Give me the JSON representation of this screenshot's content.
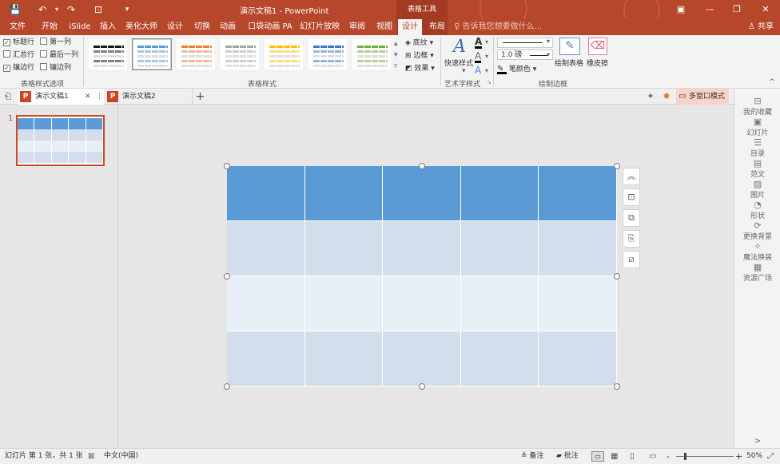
{
  "window": {
    "title": "演示文稿1 - PowerPoint",
    "context_tools": "表格工具",
    "qat": {
      "save_icon": "💾",
      "undo_icon": "↶",
      "redo_icon": "↷",
      "present_icon": "⊡",
      "customize_icon": "▾"
    },
    "controls": {
      "restore_icon": "▣",
      "minimize_icon": "—",
      "maximize_icon": "❐",
      "close_icon": "✕"
    }
  },
  "menu": {
    "tabs": [
      "文件",
      "开始",
      "iSlide",
      "插入",
      "美化大师",
      "设计",
      "切换",
      "动画",
      "口袋动画 PA",
      "幻灯片放映",
      "审阅",
      "视图",
      "设计",
      "布局"
    ],
    "active_tab_index": 12,
    "tell_me": "告诉我您想要做什么...",
    "share": "共享"
  },
  "ribbon": {
    "table_style_options": {
      "header_row": "标题行",
      "first_column": "第一列",
      "total_row": "汇总行",
      "last_column": "最后一列",
      "banded_rows": "镶边行",
      "banded_columns": "镶边列",
      "checked": {
        "header_row": true,
        "total_row": false,
        "banded_rows": true,
        "first_column": false,
        "last_column": false,
        "banded_columns": false
      },
      "group_label": "表格样式选项"
    },
    "table_styles": {
      "group_label": "表格样式",
      "swatches": [
        "#1a1a1a",
        "#5b9bd5",
        "#ed7d31",
        "#a5a5a5",
        "#ffc000",
        "#4472c4",
        "#70ad47"
      ],
      "selected_index": 1,
      "shading": "底纹",
      "borders": "边框",
      "effects": "效果"
    },
    "wordart": {
      "quick_styles": "快速样式",
      "group_label": "艺术字样式",
      "text_fill_letter": "A",
      "text_outline_letter": "A",
      "text_effects_letter": "A"
    },
    "draw_borders": {
      "pen_weight": "1.0 磅",
      "pen_color": "笔颜色",
      "draw_table": "绘制表格",
      "eraser": "橡皮擦",
      "group_label": "绘制边框"
    }
  },
  "doc_tabs": {
    "tabs": [
      "演示文稿1",
      "演示文稿2"
    ],
    "active_index": 0,
    "new_tab": "+",
    "multi_window": "多窗口模式"
  },
  "slides_pane": {
    "slide_number": "1"
  },
  "table": {
    "rows": 4,
    "cols": 5,
    "header_color": "#5b9bd5",
    "band_color_1": "#d2deeb",
    "band_color_2": "#e9eff7"
  },
  "side_pane": {
    "items": [
      {
        "label": "我的收藏",
        "icon": "⊟"
      },
      {
        "label": "幻灯片",
        "icon": "▣"
      },
      {
        "label": "目录",
        "icon": "☰"
      },
      {
        "label": "范文",
        "icon": "▤"
      },
      {
        "label": "图片",
        "icon": "▨"
      },
      {
        "label": "形状",
        "icon": "◔"
      },
      {
        "label": "更换背景",
        "icon": "⟳"
      },
      {
        "label": "魔法换装",
        "icon": "✧"
      },
      {
        "label": "资源广场",
        "icon": "▦"
      }
    ],
    "collapse_icon": "^",
    "expand_icon": ">"
  },
  "status": {
    "slide_info": "幻灯片 第 1 张，共 1 张",
    "language": "中文(中国)",
    "notes": "备注",
    "comments": "批注",
    "zoom": "50%",
    "zoom_minus": "-",
    "zoom_plus": "+"
  }
}
